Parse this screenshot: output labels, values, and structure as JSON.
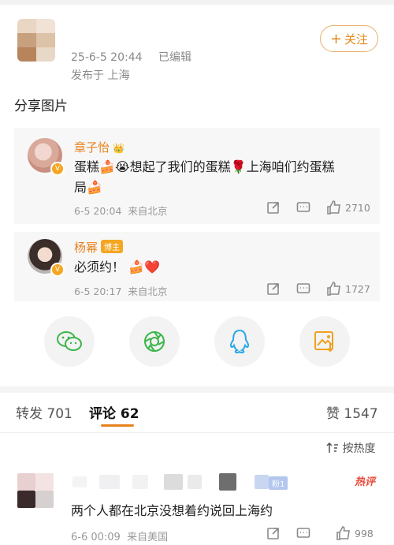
{
  "post": {
    "timestamp": "25-6-5 20:44",
    "edited": "已编辑",
    "location": "发布于 上海",
    "follow_label": "关注",
    "content": "分享图片"
  },
  "reposts": [
    {
      "name": "章子怡",
      "crown": "👑",
      "text_a": "蛋糕",
      "cake": "🍰",
      "cry": "😭",
      "text_b": "想起了我们的蛋糕",
      "rose": "🌹",
      "text_c": "上海咱们约蛋糕",
      "text_d": "局",
      "time": "6-5 20:04",
      "from": "来自北京",
      "likes": "2710"
    },
    {
      "name": "杨幂",
      "author_tag": "博主",
      "text": "必须约！",
      "cake": "🍰",
      "heart": "❤️",
      "time": "6-5 20:17",
      "from": "来自北京",
      "likes": "1727"
    }
  ],
  "share_targets": [
    "wechat-icon",
    "moments-icon",
    "qq-icon",
    "save-image-icon"
  ],
  "tabs": {
    "repost_label": "转发",
    "repost_count": "701",
    "comment_label": "评论",
    "comment_count": "62",
    "like_label": "赞",
    "like_count": "1547"
  },
  "sort_label": "按热度",
  "comment": {
    "fan_badge": "粉1",
    "hot_label": "热评",
    "text": "两个人都在北京没想着约说回上海约",
    "time": "6-6 00:09",
    "from": "来自美国",
    "likes": "998"
  },
  "colors": {
    "accent": "#e8821e",
    "follow_border": "#e6b06a",
    "hot": "#e84a3a"
  }
}
